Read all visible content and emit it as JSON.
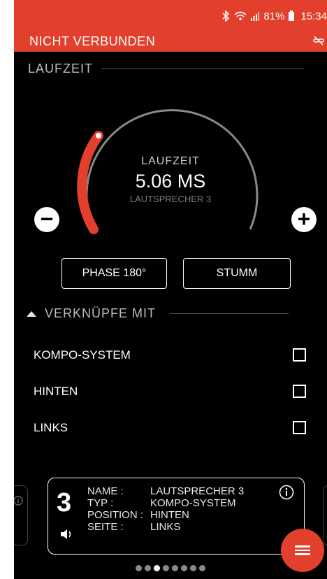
{
  "status_bar": {
    "bluetooth_icon": "bluetooth-icon",
    "wifi_icon": "wifi-icon",
    "signal_icon": "signal-icon",
    "battery": "81%",
    "time": "15:34"
  },
  "header": {
    "title": "NICHT VERBUNDEN",
    "icon": "link-off-icon"
  },
  "laufzeit_section": {
    "title": "LAUFZEIT"
  },
  "dial": {
    "label": "LAUFZEIT",
    "value": "5.06 MS",
    "speaker": "LAUTSPRECHER 3",
    "minus_label": "−",
    "plus_label": "+"
  },
  "buttons": {
    "phase": "PHASE 180°",
    "mute": "STUMM"
  },
  "link_section": {
    "title": "VERKNÜPFE MIT",
    "toggle_icon": "triangle-up-icon",
    "options": [
      {
        "label": "KOMPO-SYSTEM",
        "checked": false
      },
      {
        "label": "HINTEN",
        "checked": false
      },
      {
        "label": "LINKS",
        "checked": false
      }
    ]
  },
  "speaker_card": {
    "number": "3",
    "speaker_icon": "speaker-icon",
    "info_icon": "info-icon",
    "labels": [
      "NAME :",
      "TYP :",
      "POSITION :",
      "SEITE :"
    ],
    "values": [
      "LAUTSPRECHER 3",
      "KOMPO-SYSTEM",
      "HINTEN",
      "LINKS"
    ]
  },
  "pagination": {
    "count": 8,
    "active_index": 2
  },
  "colors": {
    "accent": "#e2402c",
    "background": "#000000",
    "text": "#ffffff"
  }
}
